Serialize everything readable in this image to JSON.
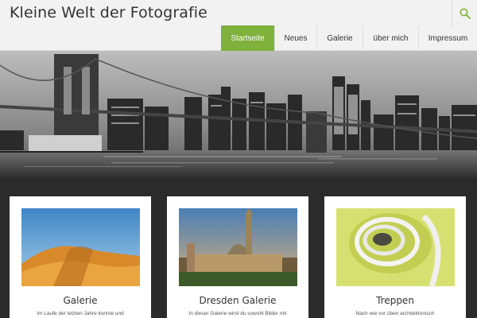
{
  "site": {
    "title": "Kleine Welt der Fotografie"
  },
  "nav": {
    "items": [
      {
        "label": "Startseite",
        "active": true
      },
      {
        "label": "Neues",
        "active": false
      },
      {
        "label": "Galerie",
        "active": false
      },
      {
        "label": "über mich",
        "active": false
      },
      {
        "label": "Impressum",
        "active": false
      }
    ]
  },
  "cards": [
    {
      "title": "Galerie",
      "text": "Im Laufe der letzten Jahre konnte und"
    },
    {
      "title": "Dresden Galerie",
      "text": "In dieser Galerie wirst du sowohl Bilder mit"
    },
    {
      "title": "Treppen",
      "text": "Nach wie vor üben architektonisch"
    }
  ],
  "colors": {
    "accent": "#7fb13c",
    "header_bg": "#f2f2f2",
    "content_bg": "#2b2b2b"
  },
  "icons": {
    "search": "search-icon"
  }
}
